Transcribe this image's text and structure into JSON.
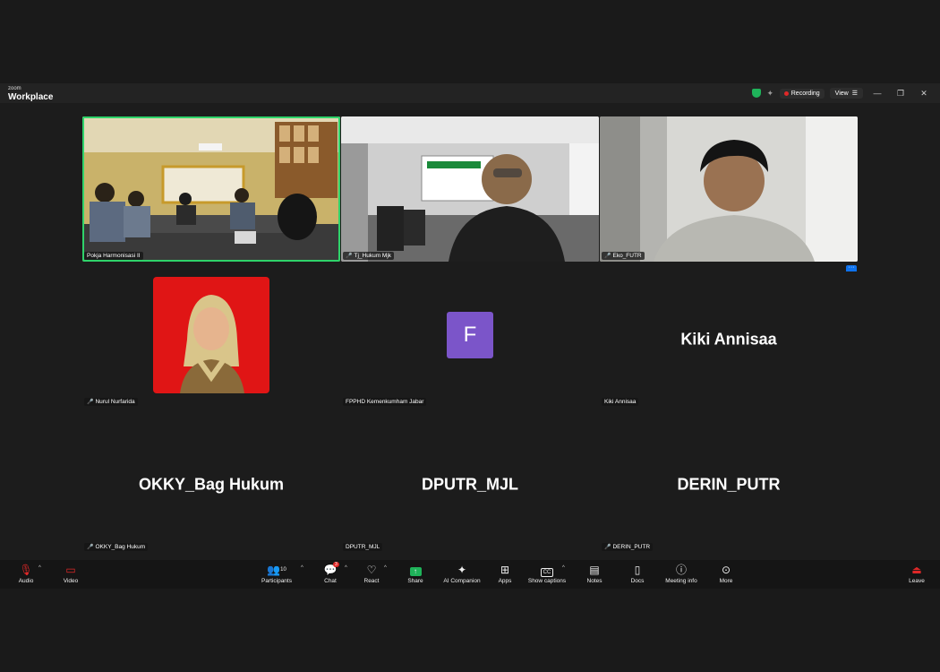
{
  "app": {
    "logo_small": "zoom",
    "logo_big": "Workplace"
  },
  "titlebar": {
    "recording_label": "Recording",
    "view_label": "View"
  },
  "participants": [
    {
      "name": "Pokja Harmonisasi II",
      "type": "video",
      "muted": false
    },
    {
      "name": "Tj_Hukum Mjk",
      "type": "video",
      "muted": true
    },
    {
      "name": "Eko_FUTR",
      "type": "video",
      "muted": true
    },
    {
      "name": "Nurul Nurfarida",
      "type": "photo",
      "muted": true
    },
    {
      "name": "FPPHD Kemenkumham Jabar",
      "type": "avatar",
      "avatar_letter": "F",
      "muted": false
    },
    {
      "name": "Kiki Annisaa",
      "type": "name",
      "display": "Kiki Annisaa",
      "muted": false
    },
    {
      "name": "OKKY_Bag Hukum",
      "type": "name",
      "display": "OKKY_Bag Hukum",
      "muted": true
    },
    {
      "name": "DPUTR_MJL",
      "type": "name",
      "display": "DPUTR_MJL",
      "muted": false
    },
    {
      "name": "DERIN_PUTR",
      "type": "name",
      "display": "DERIN_PUTR",
      "muted": true
    }
  ],
  "toolbar": {
    "audio": "Audio",
    "video": "Video",
    "participants": "Participants",
    "participants_count": "10",
    "chat": "Chat",
    "chat_badge": "3",
    "react": "React",
    "share": "Share",
    "ai_companion": "AI Companion",
    "apps": "Apps",
    "show_captions": "Show captions",
    "notes": "Notes",
    "docs": "Docs",
    "meeting_info": "Meeting info",
    "more": "More",
    "leave": "Leave"
  },
  "colors": {
    "active_speaker": "#2fd36a",
    "avatar_bg": "#7b55c9",
    "accent_blue": "#0e72ed",
    "share_green": "#1fb35a",
    "danger": "#e02828"
  }
}
